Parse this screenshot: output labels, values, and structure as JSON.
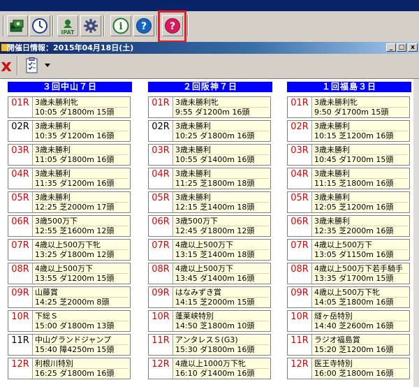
{
  "window": {
    "title": "開催日情報：2015年04月18日(土)",
    "minimize": "_",
    "restore": "□",
    "close": "x"
  },
  "toolbar": {
    "buttons": [
      {
        "name": "wallet-icon"
      },
      {
        "name": "clock-icon"
      },
      {
        "name": "ipat-icon",
        "label": "IPAT"
      },
      {
        "name": "gear-icon"
      },
      {
        "name": "info-icon",
        "label": "i"
      },
      {
        "name": "help-icon",
        "label": "?"
      },
      {
        "name": "help-red-icon",
        "label": "?"
      }
    ],
    "highlight_color": "#e0202a"
  },
  "toolbar2": {
    "close_mark": "x"
  },
  "venues": [
    {
      "name": "３回中山７日",
      "races": [
        {
          "num": "01R",
          "num_color": "red",
          "l1": "3歳未勝利牝",
          "l2": "10:05  ダ1800m 15頭"
        },
        {
          "num": "02R",
          "num_color": "black",
          "l1": "3歳未勝利",
          "l2": "10:35  ダ1200m 16頭"
        },
        {
          "num": "03R",
          "num_color": "red",
          "l1": "3歳未勝利",
          "l2": "11:05  ダ1800m 16頭"
        },
        {
          "num": "04R",
          "num_color": "red",
          "l1": "3歳未勝利",
          "l2": "11:35  ダ1200m 16頭"
        },
        {
          "num": "05R",
          "num_color": "red",
          "l1": "3歳未勝利",
          "l2": "12:25  芝2000m 17頭"
        },
        {
          "num": "06R",
          "num_color": "red",
          "l1": "3歳500万下",
          "l2": "12:55  芝1600m 12頭"
        },
        {
          "num": "07R",
          "num_color": "red",
          "l1": "4歳以上500万下牝",
          "l2": "13:25  ダ1800m 12頭"
        },
        {
          "num": "08R",
          "num_color": "red",
          "l1": "4歳以上500万下",
          "l2": "13:55  ダ1200m 15頭"
        },
        {
          "num": "09R",
          "num_color": "red",
          "l1": "山藤賞",
          "l2": "14:25  芝2000m 8頭"
        },
        {
          "num": "10R",
          "num_color": "red",
          "l1": "下総Ｓ",
          "l2": "15:00  ダ1800m 13頭"
        },
        {
          "num": "11R",
          "num_color": "black",
          "l1": "中山グランドジャンプ",
          "l2": "15:40  障4250m 15頭"
        },
        {
          "num": "12R",
          "num_color": "red",
          "l1": "利根川特別",
          "l2": "16:25  ダ1800m 16頭"
        }
      ]
    },
    {
      "name": "２回阪神７日",
      "races": [
        {
          "num": "01R",
          "num_color": "red",
          "l1": "3歳未勝利牝",
          "l2": "9:55  ダ1200m 16頭"
        },
        {
          "num": "02R",
          "num_color": "black",
          "l1": "3歳未勝利",
          "l2": "10:25  ダ1800m 16頭"
        },
        {
          "num": "03R",
          "num_color": "red",
          "l1": "3歳未勝利",
          "l2": "10:55  ダ1400m 16頭"
        },
        {
          "num": "04R",
          "num_color": "red",
          "l1": "3歳未勝利",
          "l2": "11:25  芝1800m 18頭"
        },
        {
          "num": "05R",
          "num_color": "red",
          "l1": "3歳未勝利",
          "l2": "12:15  芝1400m 18頭"
        },
        {
          "num": "06R",
          "num_color": "red",
          "l1": "3歳500万下",
          "l2": "12:45  ダ1800m 12頭"
        },
        {
          "num": "07R",
          "num_color": "red",
          "l1": "4歳以上500万下",
          "l2": "13:15  芝1400m 18頭"
        },
        {
          "num": "08R",
          "num_color": "red",
          "l1": "4歳以上500万下",
          "l2": "13:45  ダ1400m 16頭"
        },
        {
          "num": "09R",
          "num_color": "red",
          "l1": "はなみずき賞",
          "l2": "14:15  芝2000m 15頭"
        },
        {
          "num": "10R",
          "num_color": "red",
          "l1": "蓬莱峡特別",
          "l2": "14:50  芝1800m 10頭"
        },
        {
          "num": "11R",
          "num_color": "red",
          "l1": "アンタレスＳ(G3)",
          "l2": "15:30  ダ1800m 16頭"
        },
        {
          "num": "12R",
          "num_color": "red",
          "l1": "4歳以上1000万下牝",
          "l2": "16:10  ダ1400m 16頭"
        }
      ]
    },
    {
      "name": "１回福島３日",
      "races": [
        {
          "num": "01R",
          "num_color": "red",
          "l1": "3歳未勝利牝",
          "l2": "9:50  ダ1700m 15頭"
        },
        {
          "num": "02R",
          "num_color": "red",
          "l1": "3歳未勝利",
          "l2": "10:15  芝1200m 16頭"
        },
        {
          "num": "03R",
          "num_color": "red",
          "l1": "3歳未勝利",
          "l2": "10:45  ダ1700m 15頭"
        },
        {
          "num": "04R",
          "num_color": "red",
          "l1": "3歳未勝利",
          "l2": "11:15  芝1800m 16頭"
        },
        {
          "num": "05R",
          "num_color": "red",
          "l1": "3歳未勝利",
          "l2": "12:05  芝1200m 16頭"
        },
        {
          "num": "06R",
          "num_color": "red",
          "l1": "3歳未勝利",
          "l2": "12:35  芝2000m 16頭"
        },
        {
          "num": "07R",
          "num_color": "red",
          "l1": "4歳以上500万下",
          "l2": "13:05  ダ1150m 16頭"
        },
        {
          "num": "08R",
          "num_color": "red",
          "l1": "4歳以上500万下若手騎手",
          "l2": "13:35  ダ1700m 15頭"
        },
        {
          "num": "09R",
          "num_color": "red",
          "l1": "4歳以上500万下牝",
          "l2": "14:05  芝1800m 16頭"
        },
        {
          "num": "10R",
          "num_color": "red",
          "l1": "燧ヶ岳特別",
          "l2": "14:40  芝2600m 16頭"
        },
        {
          "num": "11R",
          "num_color": "red",
          "l1": "ラジオ福島賞",
          "l2": "15:20  芝1200m 16頭"
        },
        {
          "num": "12R",
          "num_color": "red",
          "l1": "医王寺特別",
          "l2": "16:00  芝1800m 16頭"
        }
      ]
    }
  ]
}
